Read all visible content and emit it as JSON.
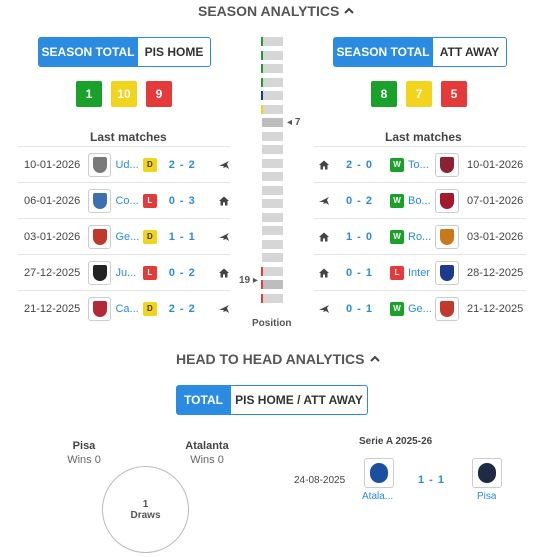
{
  "season": {
    "title": "SEASON ANALYTICS",
    "left_tabs": [
      "SEASON TOTAL",
      "PIS HOME"
    ],
    "right_tabs": [
      "SEASON TOTAL",
      "ATT AWAY"
    ],
    "left_tally": {
      "w": "1",
      "d": "10",
      "l": "9"
    },
    "right_tally": {
      "w": "8",
      "d": "7",
      "l": "5"
    },
    "last_matches_label": "Last matches",
    "left_matches": [
      {
        "date": "10-01-2026",
        "team": "Ud...",
        "result": "D",
        "score": "2 - 2",
        "venue": "plane-icon",
        "logo_color": "#7a7a7a"
      },
      {
        "date": "06-01-2026",
        "team": "Co...",
        "result": "L",
        "score": "0 - 3",
        "venue": "home-icon",
        "logo_color": "#3b6fb0"
      },
      {
        "date": "03-01-2026",
        "team": "Ge...",
        "result": "D",
        "score": "1 - 1",
        "venue": "plane-icon",
        "logo_color": "#c0392b"
      },
      {
        "date": "27-12-2025",
        "team": "Ju...",
        "result": "L",
        "score": "0 - 2",
        "venue": "home-icon",
        "logo_color": "#222222"
      },
      {
        "date": "21-12-2025",
        "team": "Ca...",
        "result": "D",
        "score": "2 - 2",
        "venue": "plane-icon",
        "logo_color": "#b5283a"
      }
    ],
    "right_matches": [
      {
        "date": "10-01-2026",
        "team": "To...",
        "result": "W",
        "score": "2 - 0",
        "venue": "home-icon",
        "logo_color": "#8b2231"
      },
      {
        "date": "07-01-2026",
        "team": "Bo...",
        "result": "W",
        "score": "0 - 2",
        "venue": "plane-icon",
        "logo_color": "#a3192e"
      },
      {
        "date": "03-01-2026",
        "team": "Ro...",
        "result": "W",
        "score": "1 - 0",
        "venue": "home-icon",
        "logo_color": "#c87a1a"
      },
      {
        "date": "28-12-2025",
        "team": "Inter",
        "result": "L",
        "score": "0 - 1",
        "venue": "home-icon",
        "logo_color": "#1d3a8f"
      },
      {
        "date": "21-12-2025",
        "team": "Ge...",
        "result": "W",
        "score": "0 - 1",
        "venue": "plane-icon",
        "logo_color": "#c0392b"
      }
    ],
    "position": {
      "label": "Position",
      "att_position": "7",
      "pis_position": "19"
    }
  },
  "h2h": {
    "title": "HEAD TO HEAD ANALYTICS",
    "tabs": [
      "TOTAL",
      "PIS HOME / ATT AWAY"
    ],
    "home_name": "Pisa",
    "home_wins": "Wins 0",
    "away_name": "Atalanta",
    "away_wins": "Wins 0",
    "draws_count": "1",
    "draws_label": "Draws",
    "competition": "Serie A 2025-26",
    "match": {
      "date": "24-08-2025",
      "home": "Atala...",
      "away": "Pisa",
      "score": "1 - 1",
      "home_color": "#1c4fa0",
      "away_color": "#1f2a44"
    }
  },
  "colors": {
    "accent": "#2a8be0",
    "win": "#1aa12a",
    "draw": "#f3d41c",
    "loss": "#e43a3a"
  }
}
